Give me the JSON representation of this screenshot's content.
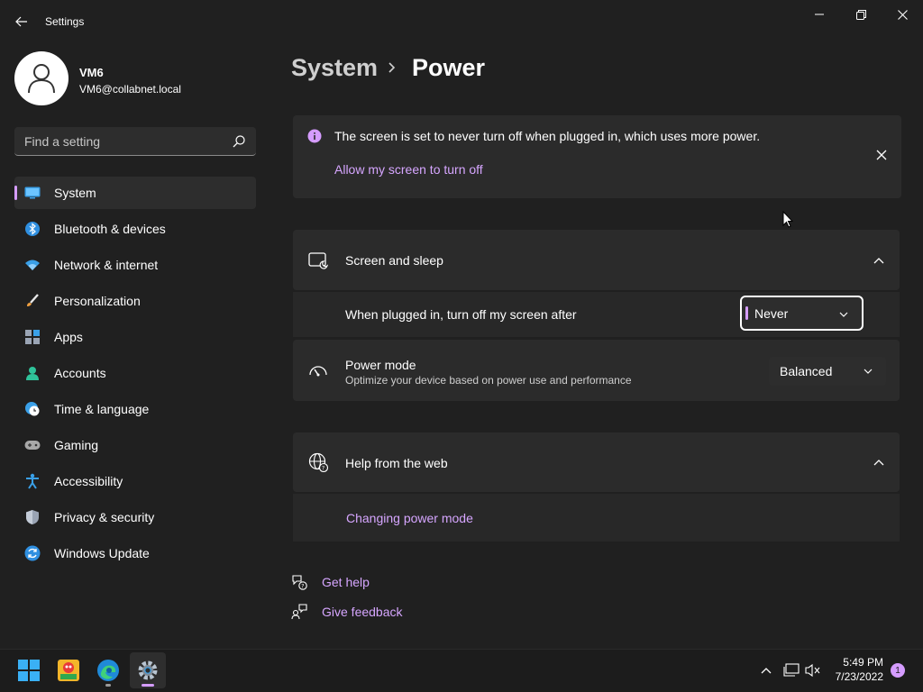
{
  "window": {
    "title": "Settings",
    "back_icon": "back-arrow-icon",
    "minimize_icon": "minimize-icon",
    "maximize_icon": "restore-icon",
    "close_icon": "close-icon"
  },
  "user": {
    "name": "VM6",
    "email": "VM6@collabnet.local"
  },
  "search": {
    "placeholder": "Find a setting",
    "value": ""
  },
  "sidebar": {
    "items": [
      {
        "label": "System",
        "icon": "system-icon",
        "active": true
      },
      {
        "label": "Bluetooth & devices",
        "icon": "bluetooth-icon"
      },
      {
        "label": "Network & internet",
        "icon": "wifi-icon"
      },
      {
        "label": "Personalization",
        "icon": "brush-icon"
      },
      {
        "label": "Apps",
        "icon": "apps-icon"
      },
      {
        "label": "Accounts",
        "icon": "accounts-icon"
      },
      {
        "label": "Time & language",
        "icon": "time-language-icon"
      },
      {
        "label": "Gaming",
        "icon": "gamepad-icon"
      },
      {
        "label": "Accessibility",
        "icon": "accessibility-icon"
      },
      {
        "label": "Privacy & security",
        "icon": "shield-icon"
      },
      {
        "label": "Windows Update",
        "icon": "update-icon"
      }
    ]
  },
  "header": {
    "crumb_parent": "System",
    "crumb_current": "Power"
  },
  "notice": {
    "text": "The screen is set to never turn off when plugged in, which uses more power.",
    "link": "Allow my screen to turn off"
  },
  "screen_sleep": {
    "title": "Screen and sleep",
    "setting_label": "When plugged in, turn off my screen after",
    "value": "Never"
  },
  "power_mode": {
    "title": "Power mode",
    "description": "Optimize your device based on power use and performance",
    "value": "Balanced"
  },
  "help_web": {
    "title": "Help from the web",
    "link": "Changing power mode"
  },
  "footer": {
    "get_help": "Get help",
    "give_feedback": "Give feedback"
  },
  "taskbar": {
    "time": "5:49 PM",
    "date": "7/23/2022",
    "notifications": "1"
  },
  "colors": {
    "accent": "#d59cff",
    "link": "#d6a6ff",
    "background": "#202020",
    "card": "#2b2b2b"
  }
}
